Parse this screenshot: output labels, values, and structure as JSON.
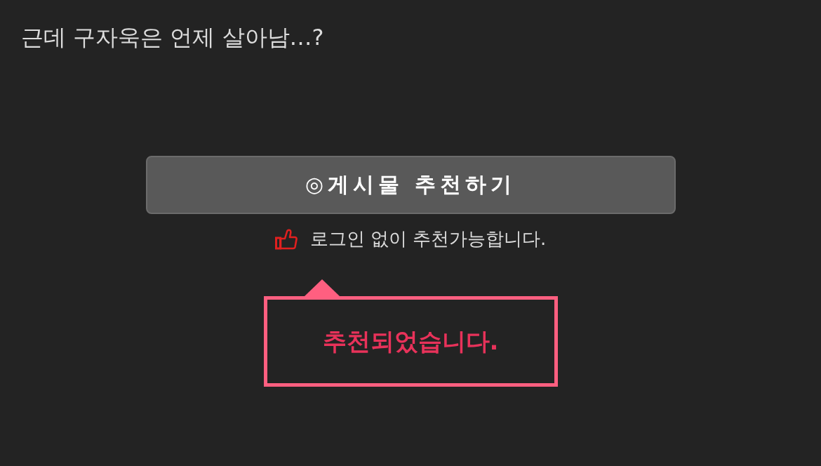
{
  "post_title": "근데 구자욱은 언제 살아남…?",
  "recommend_button": {
    "label": "◎게시물 추천하기"
  },
  "note": {
    "text": "로그인 없이 추천가능합니다."
  },
  "toast": {
    "text": "추천되었습니다."
  }
}
